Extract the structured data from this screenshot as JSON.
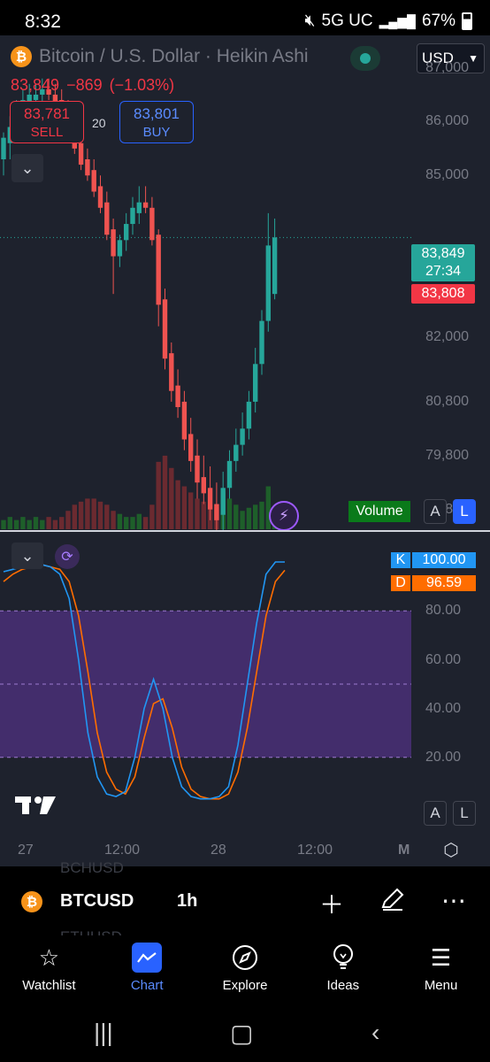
{
  "status_bar": {
    "time": "8:32",
    "network": "5G UC",
    "battery": "67%"
  },
  "header": {
    "title": "Bitcoin / U.S. Dollar · Heikin Ashi",
    "currency": "USD"
  },
  "quote": {
    "price": "83,849",
    "change": "−869",
    "change_pct": "(−1.03%)"
  },
  "trade": {
    "sell_price": "83,781",
    "sell_label": "SELL",
    "spread": "20",
    "buy_price": "83,801",
    "buy_label": "BUY"
  },
  "price_axis": {
    "labels": [
      {
        "text": "87,000",
        "y": 87000
      },
      {
        "text": "86,000",
        "y": 86000
      },
      {
        "text": "85,000",
        "y": 85000
      },
      {
        "text": "82,000",
        "y": 82000
      },
      {
        "text": "80,800",
        "y": 80800
      },
      {
        "text": "79,800",
        "y": 79800
      },
      {
        "text": "78,800",
        "y": 78800
      }
    ],
    "last_price": "83,849",
    "countdown": "27:34",
    "bid_price": "83,808"
  },
  "volume": {
    "label": "Volume",
    "a_label": "A",
    "l_label": "L"
  },
  "oscillator": {
    "k_label": "K",
    "k_value": "100.00",
    "d_label": "D",
    "d_value": "96.59",
    "levels": [
      "80.00",
      "60.00",
      "40.00",
      "20.00"
    ],
    "a_label": "A",
    "l_label": "L"
  },
  "time_axis": {
    "labels": [
      "27",
      "12:00",
      "28",
      "12:00"
    ],
    "interval_label": "M"
  },
  "symbol_bar": {
    "ghost_top": "BCHUSD",
    "ghost_bottom": "ETHUSD",
    "symbol": "BTCUSD",
    "timeframe": "1h"
  },
  "nav": [
    {
      "label": "Watchlist",
      "icon": "star-icon"
    },
    {
      "label": "Chart",
      "icon": "chart-icon"
    },
    {
      "label": "Explore",
      "icon": "compass-icon"
    },
    {
      "label": "Ideas",
      "icon": "lightbulb-icon"
    },
    {
      "label": "Menu",
      "icon": "menu-icon"
    }
  ],
  "colors": {
    "up": "#26a69a",
    "down": "#ef5350",
    "accent": "#2962ff",
    "k_line": "#2196f3",
    "d_line": "#ff6d00",
    "band": "#4a2f78"
  },
  "chart_data": {
    "type": "candlestick",
    "price_ylim": [
      78400,
      87600
    ],
    "candles": [
      {
        "o": 85300,
        "h": 85800,
        "l": 85000,
        "c": 85700
      },
      {
        "o": 85600,
        "h": 86100,
        "l": 85300,
        "c": 85900
      },
      {
        "o": 85900,
        "h": 86400,
        "l": 85700,
        "c": 86200
      },
      {
        "o": 86200,
        "h": 86600,
        "l": 86000,
        "c": 86400
      },
      {
        "o": 86300,
        "h": 86700,
        "l": 86100,
        "c": 86500
      },
      {
        "o": 86400,
        "h": 86700,
        "l": 86200,
        "c": 86500
      },
      {
        "o": 86500,
        "h": 86800,
        "l": 86300,
        "c": 86600
      },
      {
        "o": 86600,
        "h": 86800,
        "l": 86400,
        "c": 86500
      },
      {
        "o": 86500,
        "h": 86700,
        "l": 86200,
        "c": 86300
      },
      {
        "o": 86400,
        "h": 86600,
        "l": 86100,
        "c": 86200
      },
      {
        "o": 86200,
        "h": 86400,
        "l": 85700,
        "c": 85800
      },
      {
        "o": 85900,
        "h": 86100,
        "l": 85400,
        "c": 85500
      },
      {
        "o": 85600,
        "h": 85800,
        "l": 85100,
        "c": 85200
      },
      {
        "o": 85300,
        "h": 85500,
        "l": 84900,
        "c": 85000
      },
      {
        "o": 85100,
        "h": 85300,
        "l": 84600,
        "c": 84700
      },
      {
        "o": 84800,
        "h": 85000,
        "l": 84300,
        "c": 84400
      },
      {
        "o": 84500,
        "h": 84700,
        "l": 83800,
        "c": 83900
      },
      {
        "o": 84000,
        "h": 84200,
        "l": 82800,
        "c": 83500
      },
      {
        "o": 83500,
        "h": 83900,
        "l": 83300,
        "c": 83800
      },
      {
        "o": 83800,
        "h": 84300,
        "l": 83600,
        "c": 84100
      },
      {
        "o": 84100,
        "h": 84600,
        "l": 83900,
        "c": 84400
      },
      {
        "o": 84300,
        "h": 84800,
        "l": 84100,
        "c": 84500
      },
      {
        "o": 84500,
        "h": 84800,
        "l": 84300,
        "c": 84400
      },
      {
        "o": 84400,
        "h": 84600,
        "l": 83700,
        "c": 83800
      },
      {
        "o": 83900,
        "h": 84000,
        "l": 82200,
        "c": 82600
      },
      {
        "o": 82700,
        "h": 82900,
        "l": 81400,
        "c": 81600
      },
      {
        "o": 81700,
        "h": 81900,
        "l": 80800,
        "c": 81000
      },
      {
        "o": 81100,
        "h": 81400,
        "l": 80500,
        "c": 80700
      },
      {
        "o": 80800,
        "h": 81000,
        "l": 79900,
        "c": 80100
      },
      {
        "o": 80200,
        "h": 80500,
        "l": 79500,
        "c": 79700
      },
      {
        "o": 79800,
        "h": 80100,
        "l": 79000,
        "c": 79300
      },
      {
        "o": 79400,
        "h": 79800,
        "l": 78900,
        "c": 79100
      },
      {
        "o": 79200,
        "h": 79600,
        "l": 78600,
        "c": 78800
      },
      {
        "o": 78900,
        "h": 79300,
        "l": 78200,
        "c": 78600
      },
      {
        "o": 78700,
        "h": 79500,
        "l": 78400,
        "c": 79200
      },
      {
        "o": 79200,
        "h": 79900,
        "l": 79000,
        "c": 79700
      },
      {
        "o": 79700,
        "h": 80300,
        "l": 79500,
        "c": 80000
      },
      {
        "o": 80000,
        "h": 80600,
        "l": 79800,
        "c": 80300
      },
      {
        "o": 80300,
        "h": 81000,
        "l": 80100,
        "c": 80800
      },
      {
        "o": 80800,
        "h": 81800,
        "l": 80600,
        "c": 81500
      },
      {
        "o": 81500,
        "h": 82500,
        "l": 81300,
        "c": 82300
      },
      {
        "o": 82300,
        "h": 84300,
        "l": 82100,
        "c": 83700
      },
      {
        "o": 82800,
        "h": 84200,
        "l": 82700,
        "c": 83849
      }
    ],
    "volumes": [
      3,
      4,
      3,
      4,
      3,
      4,
      3,
      4,
      3,
      4,
      6,
      8,
      9,
      10,
      10,
      9,
      8,
      6,
      5,
      4,
      4,
      5,
      4,
      8,
      22,
      24,
      20,
      16,
      14,
      12,
      10,
      9,
      8,
      7,
      12,
      10,
      8,
      6,
      7,
      8,
      9,
      14,
      6
    ],
    "stoch": {
      "ylim": [
        0,
        100
      ],
      "k": [
        96,
        97,
        98,
        99,
        99,
        98,
        95,
        85,
        60,
        30,
        12,
        5,
        4,
        6,
        20,
        40,
        52,
        40,
        20,
        8,
        4,
        3,
        3,
        4,
        8,
        25,
        50,
        75,
        95,
        100,
        100
      ],
      "d": [
        92,
        95,
        97,
        98,
        99,
        98,
        97,
        92,
        78,
        55,
        30,
        14,
        7,
        5,
        12,
        28,
        42,
        44,
        32,
        16,
        7,
        4,
        3,
        3,
        5,
        14,
        32,
        55,
        78,
        92,
        96.59
      ]
    }
  }
}
